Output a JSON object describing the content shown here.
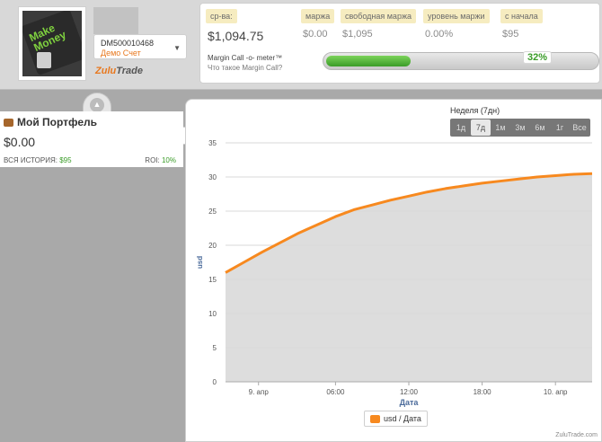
{
  "account": {
    "avatar_text": "Make Money",
    "id": "DM500010468",
    "type": "Демо Счет",
    "logo_brand": "Zulu",
    "logo_suffix": "Trade"
  },
  "stats": {
    "items": [
      {
        "label": "ср-ва:",
        "value": "$1,094.75"
      },
      {
        "label": "маржа",
        "value": "$0.00"
      },
      {
        "label": "свободная маржа",
        "value": "$1,095"
      },
      {
        "label": "уровень маржи",
        "value": "0.00%"
      },
      {
        "label": "с начала",
        "value": "$95"
      }
    ],
    "margin_call_title": "Margin Call -o- meter™",
    "margin_call_sub": "Что такое Margin Call?",
    "margin_call_pct": "32%",
    "margin_call_value": 0.32
  },
  "portfolio": {
    "title": "Мой Портфель",
    "value": "$0.00",
    "history_label": "ВСЯ ИСТОРИЯ:",
    "history_value": "$95",
    "roi_label": "ROI:",
    "roi_value": "10%"
  },
  "range": {
    "title": "Неделя (7дн)",
    "options": [
      "1д",
      "7д",
      "1м",
      "3м",
      "6м",
      "1г",
      "Все"
    ],
    "active": "7д"
  },
  "credit": "ZuluTrade.com",
  "chart_data": {
    "type": "area",
    "xlabel": "Дата",
    "ylabel": "usd",
    "ylim": [
      0,
      35
    ],
    "yticks": [
      0,
      5,
      10,
      15,
      20,
      25,
      30,
      35
    ],
    "xticks": [
      "9. апр",
      "06:00",
      "12:00",
      "18:00",
      "10. апр"
    ],
    "grid": true,
    "legend": "usd / Дата",
    "legend_position": "bottom",
    "series": [
      {
        "name": "usd / Дата",
        "color": "#f7891f",
        "x": [
          0,
          0.05,
          0.1,
          0.15,
          0.2,
          0.25,
          0.3,
          0.35,
          0.4,
          0.45,
          0.5,
          0.55,
          0.6,
          0.65,
          0.7,
          0.75,
          0.8,
          0.85,
          0.9,
          0.95,
          1
        ],
        "values": [
          16.0,
          17.5,
          19.0,
          20.4,
          21.8,
          23.0,
          24.2,
          25.2,
          25.9,
          26.6,
          27.2,
          27.8,
          28.3,
          28.7,
          29.1,
          29.4,
          29.7,
          30.0,
          30.2,
          30.4,
          30.5
        ]
      }
    ]
  }
}
